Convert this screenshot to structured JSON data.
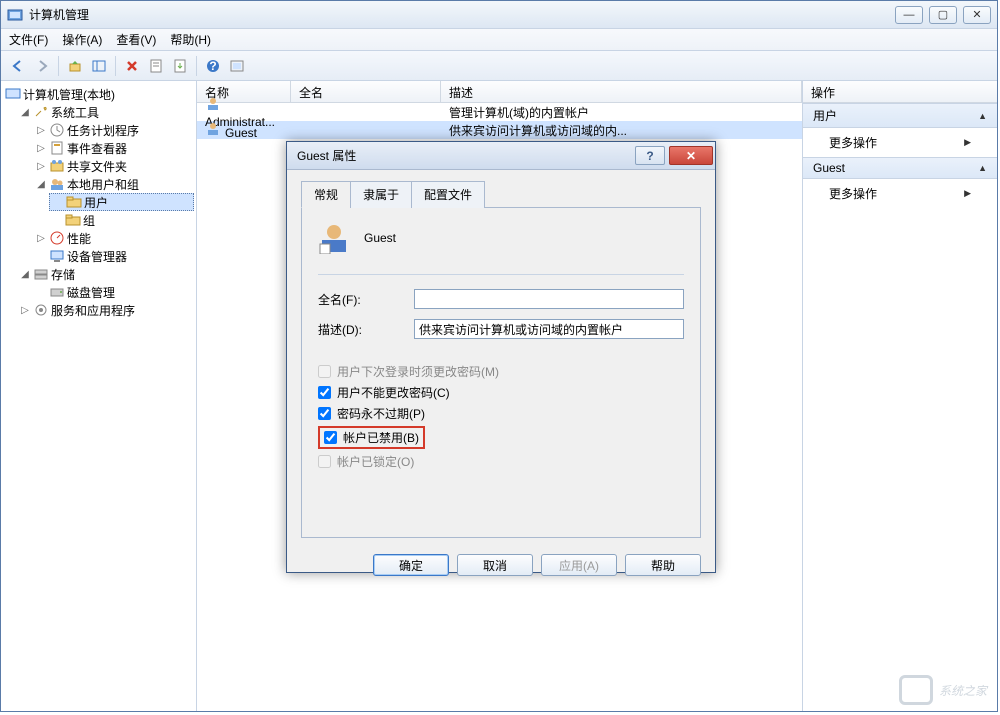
{
  "window": {
    "title": "计算机管理"
  },
  "menu": {
    "file": "文件(F)",
    "action": "操作(A)",
    "view": "查看(V)",
    "help": "帮助(H)"
  },
  "tree": {
    "root": "计算机管理(本地)",
    "system_tools": "系统工具",
    "task_scheduler": "任务计划程序",
    "event_viewer": "事件查看器",
    "shared_folders": "共享文件夹",
    "local_users": "本地用户和组",
    "users": "用户",
    "groups": "组",
    "performance": "性能",
    "device_manager": "设备管理器",
    "storage": "存储",
    "disk_management": "磁盘管理",
    "services": "服务和应用程序"
  },
  "list": {
    "header": {
      "name": "名称",
      "fullname": "全名",
      "desc": "描述"
    },
    "rows": [
      {
        "name": "Administrat...",
        "fullname": "",
        "desc": "管理计算机(域)的内置帐户"
      },
      {
        "name": "Guest",
        "fullname": "",
        "desc": "供来宾访问计算机或访问域的内..."
      }
    ]
  },
  "actions": {
    "header": "操作",
    "group1": "用户",
    "more1": "更多操作",
    "group2": "Guest",
    "more2": "更多操作"
  },
  "dialog": {
    "title": "Guest 属性",
    "tabs": {
      "general": "常规",
      "memberof": "隶属于",
      "profile": "配置文件"
    },
    "username": "Guest",
    "fields": {
      "fullname_label": "全名(F):",
      "fullname_value": "",
      "desc_label": "描述(D):",
      "desc_value": "供来宾访问计算机或访问域的内置帐户"
    },
    "checks": {
      "must_change": "用户下次登录时须更改密码(M)",
      "cannot_change": "用户不能更改密码(C)",
      "never_expire": "密码永不过期(P)",
      "disabled": "帐户已禁用(B)",
      "locked": "帐户已锁定(O)"
    },
    "buttons": {
      "ok": "确定",
      "cancel": "取消",
      "apply": "应用(A)",
      "help": "帮助"
    }
  },
  "watermark": "系统之家"
}
